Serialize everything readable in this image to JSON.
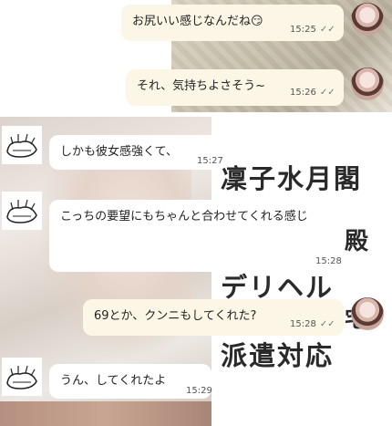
{
  "poster": {
    "line1": "凜子水月閣",
    "line2": "殿",
    "line3": "デリヘル",
    "line4": "派遣対応",
    "fragment": "宅"
  },
  "messages": [
    {
      "text": "お尻いい感じなんだね😏",
      "time": "15:25",
      "check": "✓✓"
    },
    {
      "text": "それ、気持ちよさそう~",
      "time": "15:26",
      "check": "✓✓"
    },
    {
      "text": "しかも彼女感強くて、",
      "time": "15:27"
    },
    {
      "text": "こっちの要望にもちゃんと合わせてくれる感じ",
      "time": "15:28"
    },
    {
      "text": "69とか、クンニもしてくれた?",
      "time": "15:28",
      "check": "✓✓"
    },
    {
      "text": "うん、してくれたよ",
      "time": "15:29"
    }
  ]
}
